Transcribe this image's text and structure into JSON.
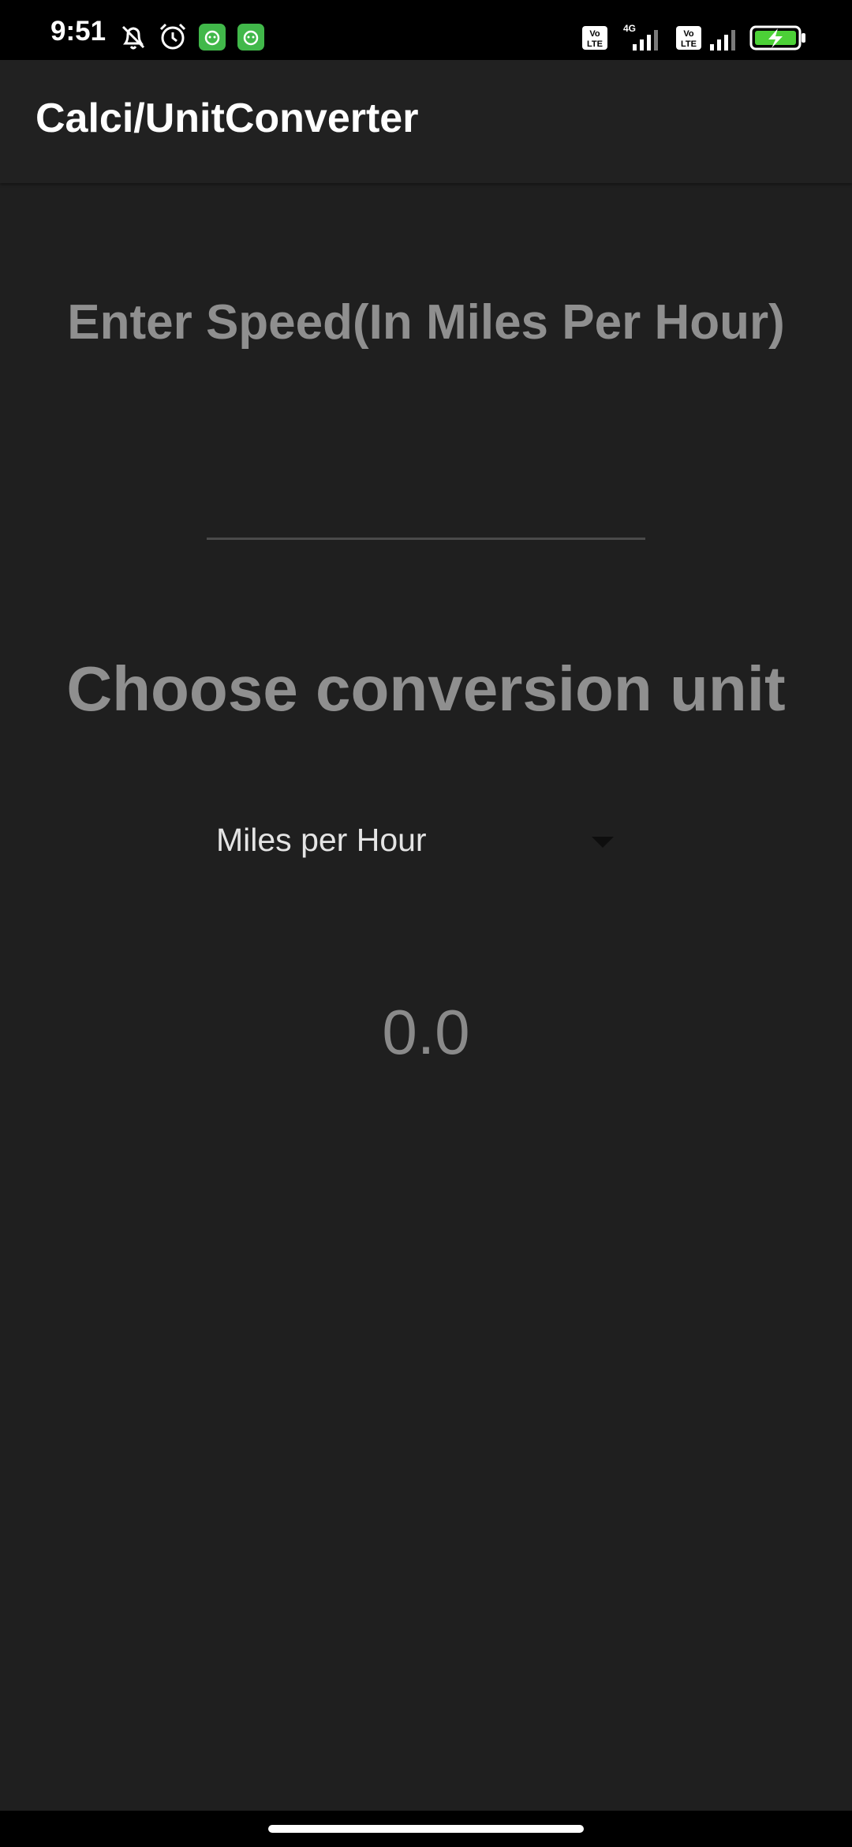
{
  "status_bar": {
    "time": "9:51",
    "icons": [
      "mute-icon",
      "alarm-icon",
      "app-notification-icon",
      "app-notification-icon",
      "volte-icon",
      "signal-4g-icon",
      "volte-icon",
      "signal-icon",
      "battery-charging-icon"
    ],
    "network_label": "4G",
    "volte_label_top": "Vo",
    "volte_label_bottom": "LTE"
  },
  "app_bar": {
    "title": "Calci/UnitConverter"
  },
  "form": {
    "speed_label": "Enter Speed(In Miles Per Hour)",
    "speed_input_value": "",
    "speed_input_placeholder": "",
    "choose_label": "Choose conversion unit",
    "unit_selected": "Miles per Hour",
    "result": "0.0"
  },
  "colors": {
    "background": "#1f1f1f",
    "app_bar": "#212121",
    "label_gray": "#8f8f8f",
    "app_badge_green": "#41b84a",
    "battery_green": "#4cd137"
  }
}
